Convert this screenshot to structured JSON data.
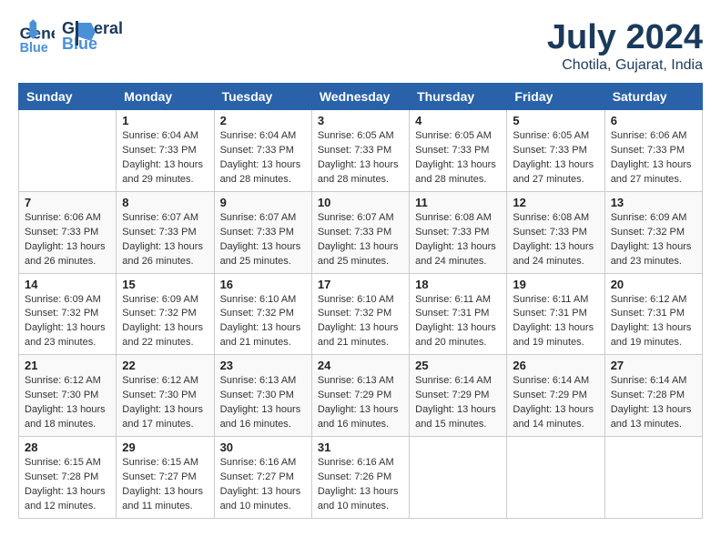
{
  "header": {
    "logo_line1": "General",
    "logo_line2": "Blue",
    "month_title": "July 2024",
    "location": "Chotila, Gujarat, India"
  },
  "weekdays": [
    "Sunday",
    "Monday",
    "Tuesday",
    "Wednesday",
    "Thursday",
    "Friday",
    "Saturday"
  ],
  "weeks": [
    [
      {
        "day": "",
        "sunrise": "",
        "sunset": "",
        "daylight": ""
      },
      {
        "day": "1",
        "sunrise": "Sunrise: 6:04 AM",
        "sunset": "Sunset: 7:33 PM",
        "daylight": "Daylight: 13 hours and 29 minutes."
      },
      {
        "day": "2",
        "sunrise": "Sunrise: 6:04 AM",
        "sunset": "Sunset: 7:33 PM",
        "daylight": "Daylight: 13 hours and 28 minutes."
      },
      {
        "day": "3",
        "sunrise": "Sunrise: 6:05 AM",
        "sunset": "Sunset: 7:33 PM",
        "daylight": "Daylight: 13 hours and 28 minutes."
      },
      {
        "day": "4",
        "sunrise": "Sunrise: 6:05 AM",
        "sunset": "Sunset: 7:33 PM",
        "daylight": "Daylight: 13 hours and 28 minutes."
      },
      {
        "day": "5",
        "sunrise": "Sunrise: 6:05 AM",
        "sunset": "Sunset: 7:33 PM",
        "daylight": "Daylight: 13 hours and 27 minutes."
      },
      {
        "day": "6",
        "sunrise": "Sunrise: 6:06 AM",
        "sunset": "Sunset: 7:33 PM",
        "daylight": "Daylight: 13 hours and 27 minutes."
      }
    ],
    [
      {
        "day": "7",
        "sunrise": "Sunrise: 6:06 AM",
        "sunset": "Sunset: 7:33 PM",
        "daylight": "Daylight: 13 hours and 26 minutes."
      },
      {
        "day": "8",
        "sunrise": "Sunrise: 6:07 AM",
        "sunset": "Sunset: 7:33 PM",
        "daylight": "Daylight: 13 hours and 26 minutes."
      },
      {
        "day": "9",
        "sunrise": "Sunrise: 6:07 AM",
        "sunset": "Sunset: 7:33 PM",
        "daylight": "Daylight: 13 hours and 25 minutes."
      },
      {
        "day": "10",
        "sunrise": "Sunrise: 6:07 AM",
        "sunset": "Sunset: 7:33 PM",
        "daylight": "Daylight: 13 hours and 25 minutes."
      },
      {
        "day": "11",
        "sunrise": "Sunrise: 6:08 AM",
        "sunset": "Sunset: 7:33 PM",
        "daylight": "Daylight: 13 hours and 24 minutes."
      },
      {
        "day": "12",
        "sunrise": "Sunrise: 6:08 AM",
        "sunset": "Sunset: 7:33 PM",
        "daylight": "Daylight: 13 hours and 24 minutes."
      },
      {
        "day": "13",
        "sunrise": "Sunrise: 6:09 AM",
        "sunset": "Sunset: 7:32 PM",
        "daylight": "Daylight: 13 hours and 23 minutes."
      }
    ],
    [
      {
        "day": "14",
        "sunrise": "Sunrise: 6:09 AM",
        "sunset": "Sunset: 7:32 PM",
        "daylight": "Daylight: 13 hours and 23 minutes."
      },
      {
        "day": "15",
        "sunrise": "Sunrise: 6:09 AM",
        "sunset": "Sunset: 7:32 PM",
        "daylight": "Daylight: 13 hours and 22 minutes."
      },
      {
        "day": "16",
        "sunrise": "Sunrise: 6:10 AM",
        "sunset": "Sunset: 7:32 PM",
        "daylight": "Daylight: 13 hours and 21 minutes."
      },
      {
        "day": "17",
        "sunrise": "Sunrise: 6:10 AM",
        "sunset": "Sunset: 7:32 PM",
        "daylight": "Daylight: 13 hours and 21 minutes."
      },
      {
        "day": "18",
        "sunrise": "Sunrise: 6:11 AM",
        "sunset": "Sunset: 7:31 PM",
        "daylight": "Daylight: 13 hours and 20 minutes."
      },
      {
        "day": "19",
        "sunrise": "Sunrise: 6:11 AM",
        "sunset": "Sunset: 7:31 PM",
        "daylight": "Daylight: 13 hours and 19 minutes."
      },
      {
        "day": "20",
        "sunrise": "Sunrise: 6:12 AM",
        "sunset": "Sunset: 7:31 PM",
        "daylight": "Daylight: 13 hours and 19 minutes."
      }
    ],
    [
      {
        "day": "21",
        "sunrise": "Sunrise: 6:12 AM",
        "sunset": "Sunset: 7:30 PM",
        "daylight": "Daylight: 13 hours and 18 minutes."
      },
      {
        "day": "22",
        "sunrise": "Sunrise: 6:12 AM",
        "sunset": "Sunset: 7:30 PM",
        "daylight": "Daylight: 13 hours and 17 minutes."
      },
      {
        "day": "23",
        "sunrise": "Sunrise: 6:13 AM",
        "sunset": "Sunset: 7:30 PM",
        "daylight": "Daylight: 13 hours and 16 minutes."
      },
      {
        "day": "24",
        "sunrise": "Sunrise: 6:13 AM",
        "sunset": "Sunset: 7:29 PM",
        "daylight": "Daylight: 13 hours and 16 minutes."
      },
      {
        "day": "25",
        "sunrise": "Sunrise: 6:14 AM",
        "sunset": "Sunset: 7:29 PM",
        "daylight": "Daylight: 13 hours and 15 minutes."
      },
      {
        "day": "26",
        "sunrise": "Sunrise: 6:14 AM",
        "sunset": "Sunset: 7:29 PM",
        "daylight": "Daylight: 13 hours and 14 minutes."
      },
      {
        "day": "27",
        "sunrise": "Sunrise: 6:14 AM",
        "sunset": "Sunset: 7:28 PM",
        "daylight": "Daylight: 13 hours and 13 minutes."
      }
    ],
    [
      {
        "day": "28",
        "sunrise": "Sunrise: 6:15 AM",
        "sunset": "Sunset: 7:28 PM",
        "daylight": "Daylight: 13 hours and 12 minutes."
      },
      {
        "day": "29",
        "sunrise": "Sunrise: 6:15 AM",
        "sunset": "Sunset: 7:27 PM",
        "daylight": "Daylight: 13 hours and 11 minutes."
      },
      {
        "day": "30",
        "sunrise": "Sunrise: 6:16 AM",
        "sunset": "Sunset: 7:27 PM",
        "daylight": "Daylight: 13 hours and 10 minutes."
      },
      {
        "day": "31",
        "sunrise": "Sunrise: 6:16 AM",
        "sunset": "Sunset: 7:26 PM",
        "daylight": "Daylight: 13 hours and 10 minutes."
      },
      {
        "day": "",
        "sunrise": "",
        "sunset": "",
        "daylight": ""
      },
      {
        "day": "",
        "sunrise": "",
        "sunset": "",
        "daylight": ""
      },
      {
        "day": "",
        "sunrise": "",
        "sunset": "",
        "daylight": ""
      }
    ]
  ]
}
